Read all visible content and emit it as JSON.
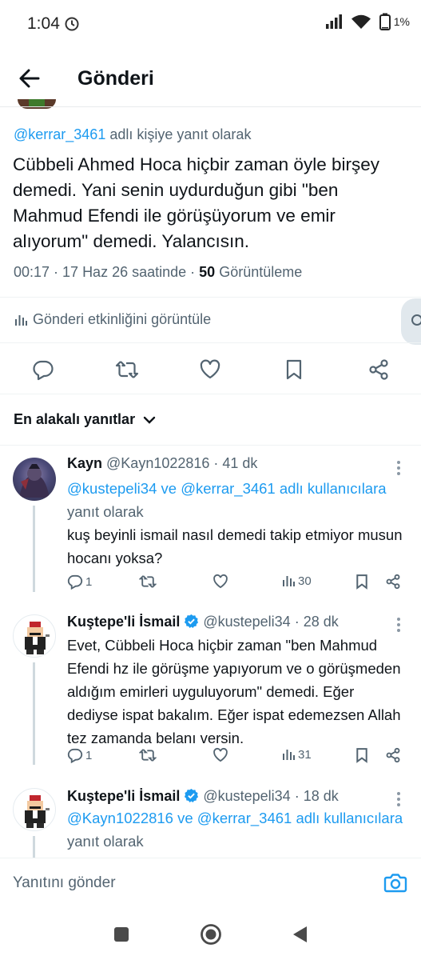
{
  "status_bar": {
    "time": "1:04",
    "battery": "1%"
  },
  "header": {
    "title": "Gönderi"
  },
  "main_tweet": {
    "reply_prefix_handle": "@kerrar_3461",
    "reply_suffix": "adlı kişiye yanıt olarak",
    "text": "Cübbeli Ahmed Hoca hiçbir zaman öyle birşey demedi. Yani senin uydurduğun gibi \"ben Mahmud Efendi ile görüşüyorum ve emir alıyorum\" demedi. Yalancısın.",
    "time": "00:17 · 17 Haz 26 saatinde · ",
    "views_count": "50",
    "views_label": " Görüntüleme",
    "activity_label": "Gönderi etkinliğini görüntüle"
  },
  "sort": {
    "label": "En alakalı yanıtlar"
  },
  "replies": [
    {
      "name": "Kayn",
      "handle": "@Kayn1022816",
      "age": " · 41 dk",
      "reply_to_link": "@kustepeli34 ve @kerrar_3461 adlı kullanıcılara",
      "reply_to_suffix": " yanıt olarak",
      "text": "kuş beyinli ismail nasıl demedi takip etmiyor musun hocanı yoksa?",
      "reply_count": "1",
      "views": "30"
    },
    {
      "name": "Kuştepe'li İsmail",
      "handle": "@kustepeli34",
      "age": " · 28 dk",
      "text": "Evet, Cübbeli Hoca hiçbir zaman \"ben Mahmud Efendi hz ile görüşme yapıyorum ve o görüşmeden aldığım emirleri uyguluyorum\" demedi. Eğer dediyse ispat bakalım. Eğer ispat edemezsen Allah tez zamanda belanı versin.",
      "reply_count": "1",
      "views": "31"
    },
    {
      "name": "Kuştepe'li İsmail",
      "handle": "@kustepeli34",
      "age": " · 18 dk",
      "reply_to_link": "@Kayn1022816 ve @kerrar_3461 adlı kullanıcılara",
      "reply_to_suffix": " yanıt olarak"
    }
  ],
  "compose": {
    "placeholder": "Yanıtını gönder"
  },
  "colors": {
    "accent": "#1d9bf0",
    "muted": "#536471",
    "verified": "#1d9bf0"
  }
}
